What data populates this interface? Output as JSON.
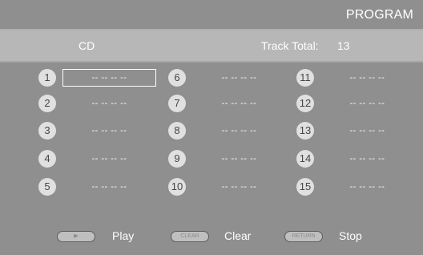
{
  "screen": {
    "title": "PROGRAM",
    "source": "CD",
    "track_total_label": "Track Total:",
    "track_total_value": "13"
  },
  "slots": [
    {
      "number": "1",
      "track": "-- -- -- --",
      "selected": true
    },
    {
      "number": "2",
      "track": "-- -- -- --"
    },
    {
      "number": "3",
      "track": "-- -- -- --"
    },
    {
      "number": "4",
      "track": "-- -- -- --"
    },
    {
      "number": "5",
      "track": "-- -- -- --"
    },
    {
      "number": "6",
      "track": "-- -- -- --"
    },
    {
      "number": "7",
      "track": "-- -- -- --"
    },
    {
      "number": "8",
      "track": "-- -- -- --"
    },
    {
      "number": "9",
      "track": "-- -- -- --"
    },
    {
      "number": "10",
      "track": "-- -- -- --"
    },
    {
      "number": "11",
      "track": "-- -- -- --"
    },
    {
      "number": "12",
      "track": "-- -- -- --"
    },
    {
      "number": "13",
      "track": "-- -- -- --"
    },
    {
      "number": "14",
      "track": "-- -- -- --"
    },
    {
      "number": "15",
      "track": "-- -- -- --"
    }
  ],
  "controls": {
    "play": {
      "key": "▶",
      "label": "Play"
    },
    "clear": {
      "key": "CLEAR",
      "label": "Clear"
    },
    "return": {
      "key": "RETURN",
      "label": "Stop"
    }
  },
  "colors": {
    "background": "#8f8f8f",
    "header_band": "#b7b7b7",
    "badge": "#e0e0e0",
    "text": "#ffffff"
  }
}
